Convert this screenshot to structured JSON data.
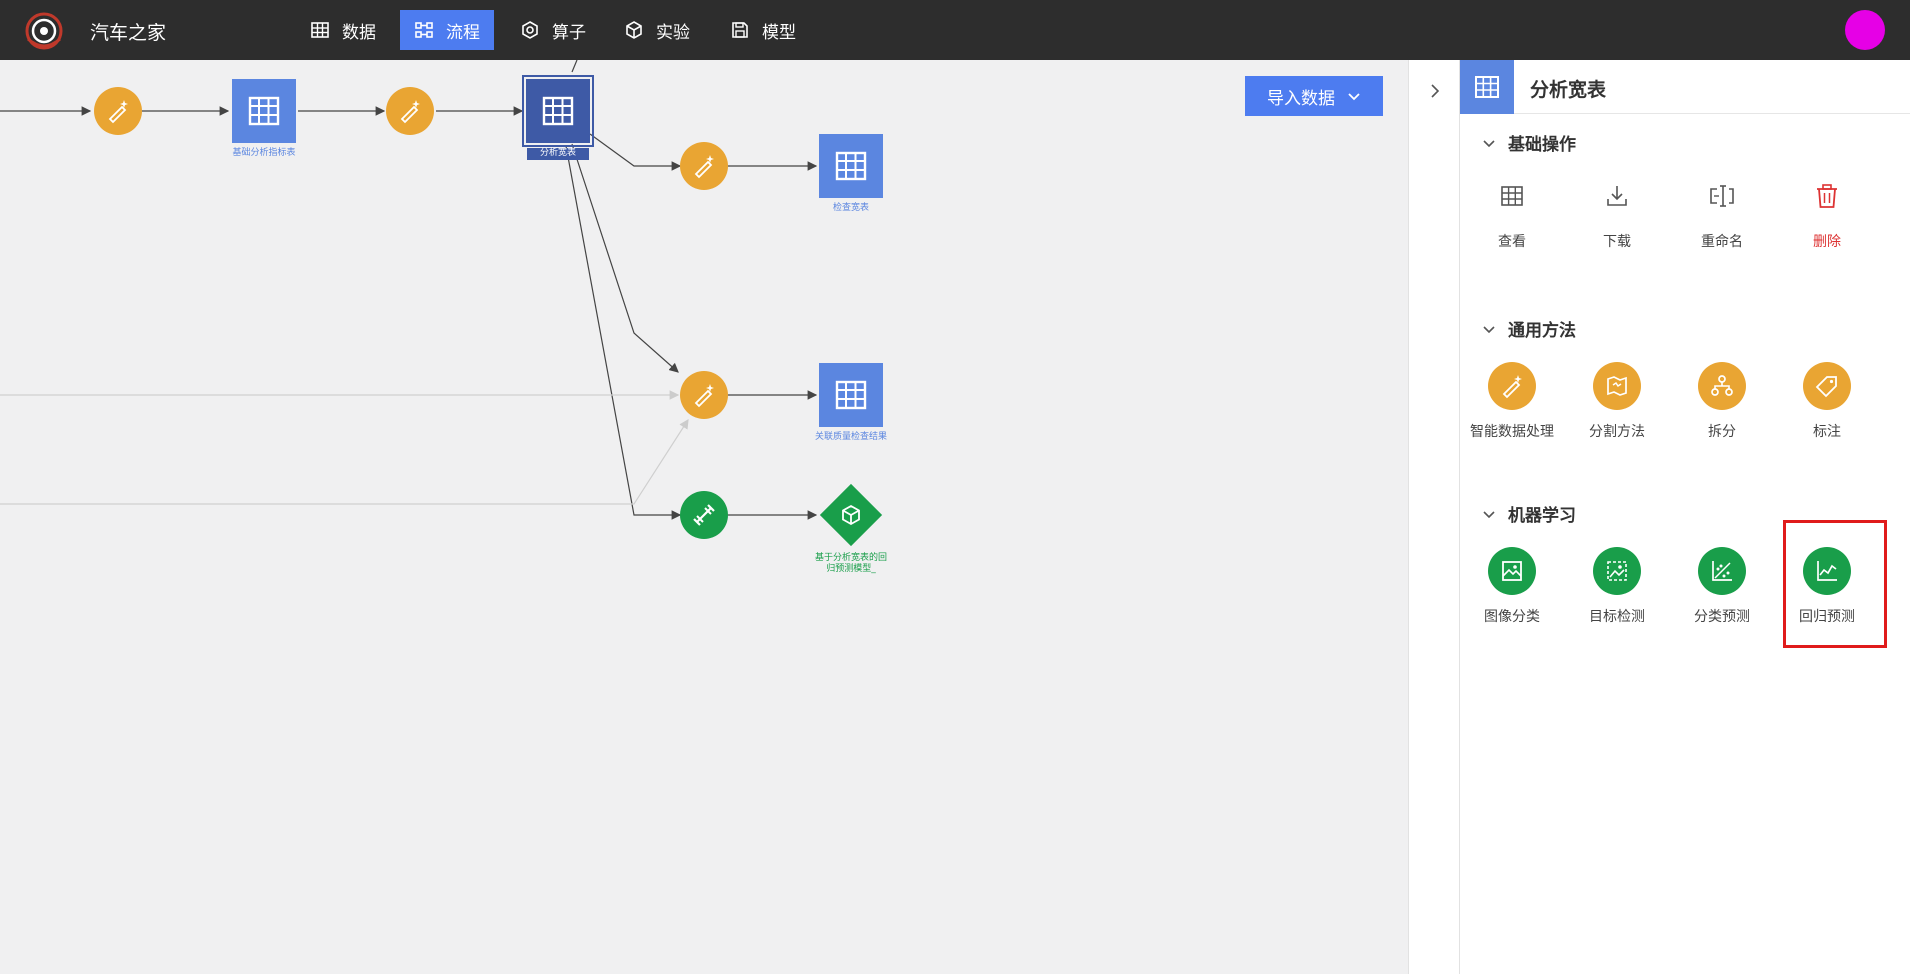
{
  "app": {
    "title": "汽车之家"
  },
  "nav": [
    {
      "label": "数据",
      "icon": "table-icon",
      "active": false
    },
    {
      "label": "流程",
      "icon": "flow-icon",
      "active": true
    },
    {
      "label": "算子",
      "icon": "gear-icon",
      "active": false
    },
    {
      "label": "实验",
      "icon": "cube-icon",
      "active": false
    },
    {
      "label": "模型",
      "icon": "save-icon",
      "active": false
    }
  ],
  "canvas": {
    "import_button": "导入数据",
    "nodes": {
      "base_table": "基础分析指标表",
      "wide_table": "分析宽表",
      "check_table": "检查宽表",
      "quality_result": "关联质量检查结果",
      "regression_model": "基于分析宽表的回归预测模型_"
    }
  },
  "panel": {
    "title": "分析宽表",
    "sections": [
      {
        "title": "基础操作",
        "tools": [
          {
            "label": "查看",
            "icon": "table-icon"
          },
          {
            "label": "下载",
            "icon": "download-icon"
          },
          {
            "label": "重命名",
            "icon": "rename-icon"
          },
          {
            "label": "删除",
            "icon": "trash-icon",
            "color": "#dd3333"
          }
        ]
      },
      {
        "title": "通用方法",
        "tools": [
          {
            "label": "智能数据处理",
            "icon": "magic-wand-icon"
          },
          {
            "label": "分割方法",
            "icon": "split-map-icon"
          },
          {
            "label": "拆分",
            "icon": "hierarchy-icon"
          },
          {
            "label": "标注",
            "icon": "tag-icon"
          }
        ]
      },
      {
        "title": "机器学习",
        "tools": [
          {
            "label": "图像分类",
            "icon": "image-classify-icon"
          },
          {
            "label": "目标检测",
            "icon": "object-detect-icon"
          },
          {
            "label": "分类预测",
            "icon": "scatter-icon"
          },
          {
            "label": "回归预测",
            "icon": "line-chart-icon"
          }
        ]
      }
    ]
  },
  "colors": {
    "accent": "#4d7cf0",
    "orange": "#e9a533",
    "green": "#199e4a",
    "table_blue": "#5b86e0",
    "highlight": "#e01b1b"
  }
}
